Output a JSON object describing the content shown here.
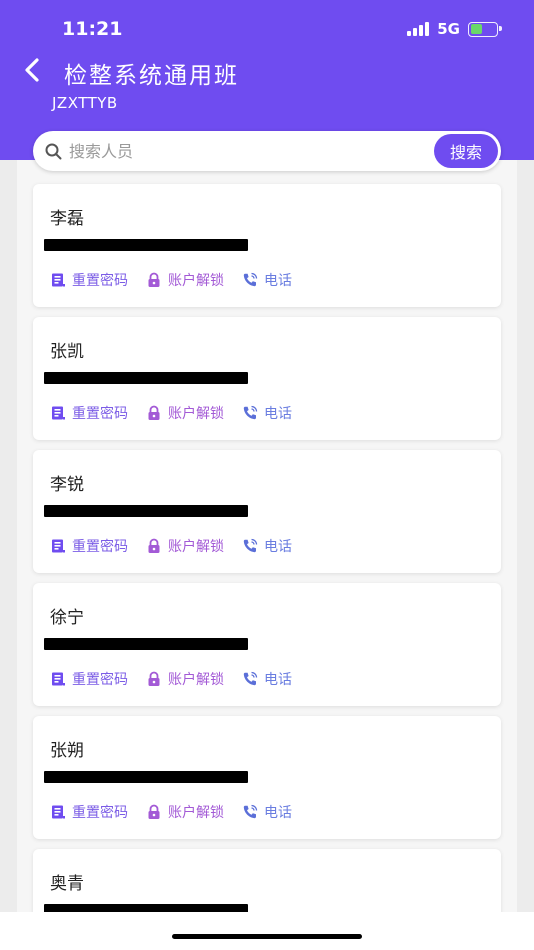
{
  "status_bar": {
    "time": "11:21",
    "network": "5G",
    "battery_level": 0.45,
    "battery_color": "#6ad968"
  },
  "header": {
    "back_icon": "chevron-left-icon",
    "title": "检整系统通用班",
    "subtitle": "JZXTTYB",
    "background_color": "#6f4cf0"
  },
  "search": {
    "placeholder": "搜索人员",
    "value": "",
    "button_label": "搜索",
    "icon": "search-icon"
  },
  "actions": {
    "reset_password": "重置密码",
    "unlock_account": "账户解锁",
    "phone": "电话"
  },
  "people": [
    {
      "name": "李磊"
    },
    {
      "name": "张凯"
    },
    {
      "name": "李锐"
    },
    {
      "name": "徐宁"
    },
    {
      "name": "张朔"
    },
    {
      "name": "奥青"
    }
  ]
}
